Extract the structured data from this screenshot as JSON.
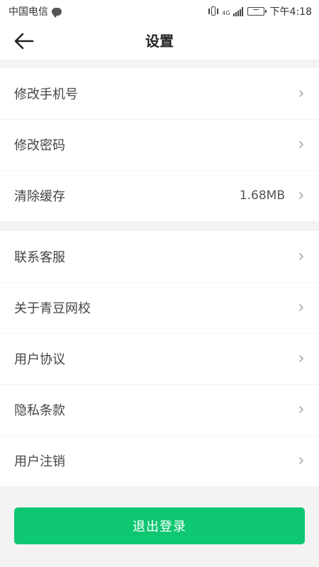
{
  "status_bar": {
    "carrier": "中国电信",
    "network_type": "4G",
    "time": "下午4:18"
  },
  "header": {
    "title": "设置",
    "back_icon": "arrow-left-icon"
  },
  "settings": {
    "group1": [
      {
        "label": "修改手机号",
        "value": ""
      },
      {
        "label": "修改密码",
        "value": ""
      },
      {
        "label": "清除缓存",
        "value": "1.68MB"
      }
    ],
    "group2": [
      {
        "label": "联系客服",
        "value": ""
      },
      {
        "label": "关于青豆网校",
        "value": ""
      },
      {
        "label": "用户协议",
        "value": ""
      },
      {
        "label": "隐私条款",
        "value": ""
      },
      {
        "label": "用户注销",
        "value": ""
      }
    ]
  },
  "logout": {
    "label": "退出登录"
  },
  "colors": {
    "accent": "#0ec771",
    "background": "#f3f3f3",
    "row_text": "#444444"
  }
}
